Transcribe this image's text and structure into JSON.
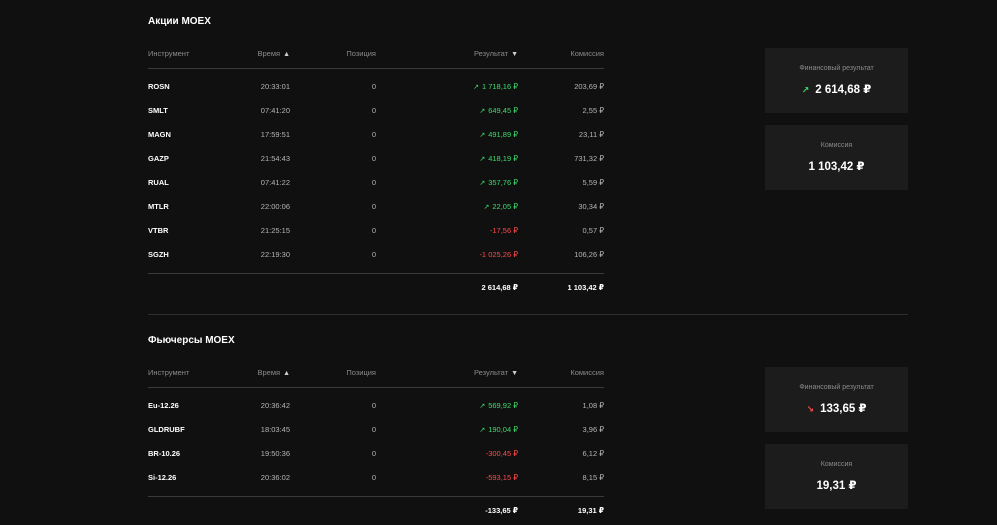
{
  "columns": {
    "instrument": "Инструмент",
    "time": "Время",
    "position": "Позиция",
    "result": "Результат",
    "commission": "Комиссия"
  },
  "sections": [
    {
      "title": "Акции MOEX",
      "rows": [
        {
          "instrument": "ROSN",
          "time": "20:33:01",
          "position": "0",
          "result": "1 718,16 ₽",
          "sign": "positive",
          "commission": "203,69 ₽"
        },
        {
          "instrument": "SMLT",
          "time": "07:41:20",
          "position": "0",
          "result": "649,45 ₽",
          "sign": "positive",
          "commission": "2,55 ₽"
        },
        {
          "instrument": "MAGN",
          "time": "17:59:51",
          "position": "0",
          "result": "491,89 ₽",
          "sign": "positive",
          "commission": "23,11 ₽"
        },
        {
          "instrument": "GAZP",
          "time": "21:54:43",
          "position": "0",
          "result": "418,19 ₽",
          "sign": "positive",
          "commission": "731,32 ₽"
        },
        {
          "instrument": "RUAL",
          "time": "07:41:22",
          "position": "0",
          "result": "357,76 ₽",
          "sign": "positive",
          "commission": "5,59 ₽"
        },
        {
          "instrument": "MTLR",
          "time": "22:00:06",
          "position": "0",
          "result": "22,05 ₽",
          "sign": "positive",
          "commission": "30,34 ₽"
        },
        {
          "instrument": "VTBR",
          "time": "21:25:15",
          "position": "0",
          "result": "-17,56 ₽",
          "sign": "negative",
          "commission": "0,57 ₽"
        },
        {
          "instrument": "SGZH",
          "time": "22:19:30",
          "position": "0",
          "result": "-1 025,26 ₽",
          "sign": "negative",
          "commission": "106,26 ₽"
        }
      ],
      "total_result": "2 614,68 ₽",
      "total_commission": "1 103,42 ₽",
      "card_result_label": "Финансовый результат",
      "card_result_value": "2 614,68 ₽",
      "card_result_sign": "positive",
      "card_commission_label": "Комиссия",
      "card_commission_value": "1 103,42 ₽"
    },
    {
      "title": "Фьючерсы MOEX",
      "rows": [
        {
          "instrument": "Eu-12.26",
          "time": "20:36:42",
          "position": "0",
          "result": "569,92 ₽",
          "sign": "positive",
          "commission": "1,08 ₽"
        },
        {
          "instrument": "GLDRUBF",
          "time": "18:03:45",
          "position": "0",
          "result": "190,04 ₽",
          "sign": "positive",
          "commission": "3,96 ₽"
        },
        {
          "instrument": "BR-10.26",
          "time": "19:50:36",
          "position": "0",
          "result": "-300,45 ₽",
          "sign": "negative",
          "commission": "6,12 ₽"
        },
        {
          "instrument": "Si-12.26",
          "time": "20:36:02",
          "position": "0",
          "result": "-593,15 ₽",
          "sign": "negative",
          "commission": "8,15 ₽"
        }
      ],
      "total_result": "-133,65 ₽",
      "total_commission": "19,31 ₽",
      "card_result_label": "Финансовый результат",
      "card_result_value": "133,65 ₽",
      "card_result_sign": "negative",
      "card_commission_label": "Комиссия",
      "card_commission_value": "19,31 ₽"
    }
  ],
  "icons": {
    "sort_asc": "chevron-up-icon",
    "sort_desc": "chevron-down-icon",
    "trend_up": "trend-up-icon",
    "trend_down": "trend-down-icon"
  },
  "colors": {
    "positive": "#3ddc6b",
    "negative": "#ff4a4a",
    "background": "#101010",
    "card": "#1c1c1c"
  }
}
